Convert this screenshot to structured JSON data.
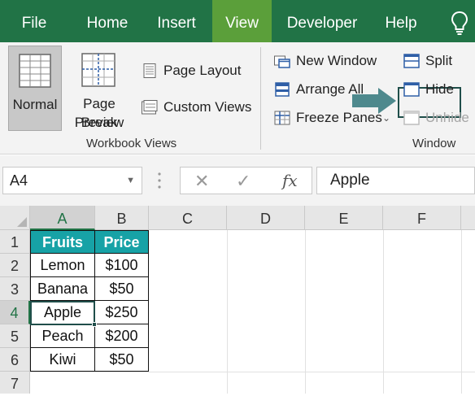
{
  "tabs": [
    "File",
    "Home",
    "Insert",
    "View",
    "Developer",
    "Help"
  ],
  "active_tab": "View",
  "ribbon": {
    "workbook_views": {
      "normal": "Normal",
      "page_break": [
        "Page Break",
        "Preview"
      ],
      "page_layout": "Page Layout",
      "custom_views": "Custom Views",
      "group_label": "Workbook Views"
    },
    "window": {
      "new_window": "New Window",
      "arrange_all": "Arrange All",
      "freeze_panes": "Freeze Panes",
      "split": "Split",
      "hide": "Hide",
      "unhide": "Unhide",
      "group_label": "Window"
    }
  },
  "formula_bar": {
    "name_box": "A4",
    "cancel": "✕",
    "enter": "✓",
    "fx": "fx",
    "value": "Apple"
  },
  "columns": [
    "A",
    "B",
    "C",
    "D",
    "E",
    "F"
  ],
  "rows": [
    "1",
    "2",
    "3",
    "4",
    "5",
    "6",
    "7"
  ],
  "selected_column": "A",
  "selected_row": "4",
  "table": {
    "headers": [
      "Fruits",
      "Price"
    ],
    "rows": [
      [
        "Lemon",
        "$100"
      ],
      [
        "Banana",
        "$50"
      ],
      [
        "Apple",
        "$250"
      ],
      [
        "Peach",
        "$200"
      ],
      [
        "Kiwi",
        "$50"
      ]
    ]
  },
  "colors": {
    "tab_bar": "#217346",
    "active_tab": "#5b9f3a",
    "table_header": "#17a2a6",
    "highlight": "#1f4e4a"
  }
}
